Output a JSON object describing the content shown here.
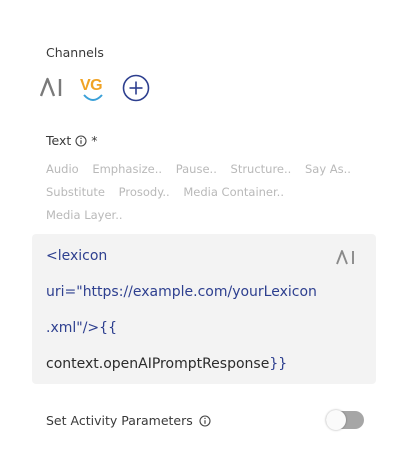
{
  "channels": {
    "label": "Channels",
    "items": [
      {
        "name": "AI",
        "icon": "ai-logo-icon",
        "color": "#7a7a7a"
      },
      {
        "name": "VG",
        "icon": "vg-logo-icon",
        "color": "#f0a325",
        "selected": true,
        "underline_color": "#3aa0d8"
      }
    ],
    "add_icon": "plus-circle-icon",
    "add_color": "#2d3f8f"
  },
  "text_field": {
    "label": "Text",
    "required_marker": "*",
    "info_icon": "info-icon",
    "ssml_tags": [
      "Audio",
      "Emphasize..",
      "Pause..",
      "Structure..",
      "Say As..",
      "Substitute",
      "Prosody..",
      "Media Container..",
      "Media Layer.."
    ],
    "value_lines": [
      "<lexicon",
      "uri=\"https://example.com/yourLexicon",
      ".xml\"/>",
      "context.openAIPromptResponse"
    ],
    "open_braces": "{{",
    "close_braces": "}}",
    "ai_icon": "ai-logo-icon"
  },
  "activity_parameters": {
    "label": "Set Activity Parameters",
    "info_icon": "info-icon",
    "toggle_on": false
  }
}
